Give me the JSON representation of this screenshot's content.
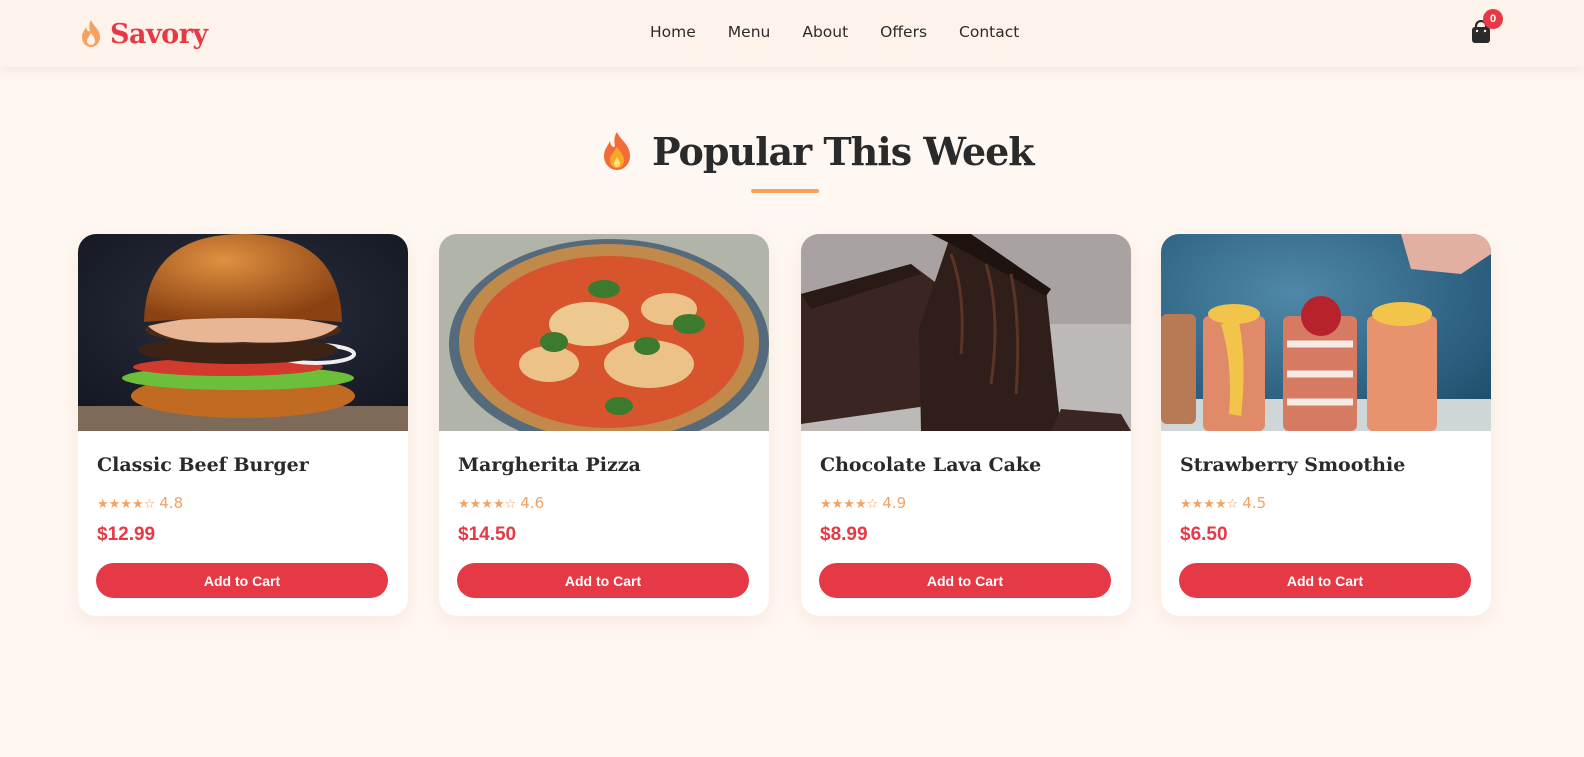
{
  "brand": {
    "name": "Savory",
    "color": "#e63946"
  },
  "nav": {
    "links": [
      {
        "label": "Home"
      },
      {
        "label": "Menu"
      },
      {
        "label": "About"
      },
      {
        "label": "Offers"
      },
      {
        "label": "Contact"
      }
    ]
  },
  "cart": {
    "count": "0",
    "icon": "shopping-bag-icon"
  },
  "section": {
    "title": "Popular This Week",
    "icon": "fire-icon",
    "accent": "#f4a261"
  },
  "products": [
    {
      "name": "Classic Beef Burger",
      "stars": "★★★★☆",
      "rating": "4.8",
      "price": "$12.99",
      "button": "Add to Cart",
      "image": "burger"
    },
    {
      "name": "Margherita Pizza",
      "stars": "★★★★☆",
      "rating": "4.6",
      "price": "$14.50",
      "button": "Add to Cart",
      "image": "pizza"
    },
    {
      "name": "Chocolate Lava Cake",
      "stars": "★★★★☆",
      "rating": "4.9",
      "price": "$8.99",
      "button": "Add to Cart",
      "image": "cake"
    },
    {
      "name": "Strawberry Smoothie",
      "stars": "★★★★☆",
      "rating": "4.5",
      "price": "$6.50",
      "button": "Add to Cart",
      "image": "smoothie"
    }
  ]
}
